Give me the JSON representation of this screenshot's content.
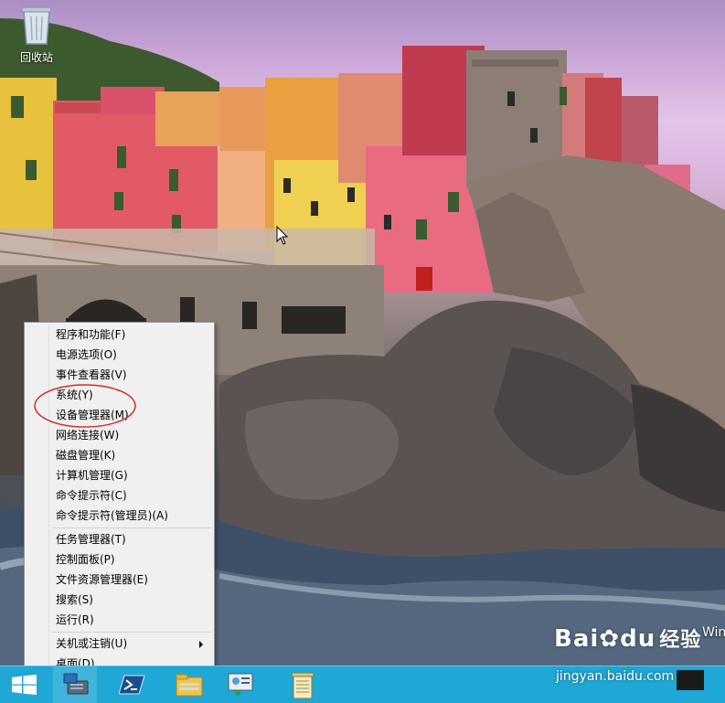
{
  "desktop": {
    "recycle_bin_label": "回收站",
    "edge_text": "Win"
  },
  "watermark": {
    "brand": "Bai",
    "brand_suffix": "du",
    "brand_cn": "经验",
    "url": "jingyan.baidu.com"
  },
  "context_menu": {
    "groups": [
      [
        "程序和功能(F)",
        "电源选项(O)",
        "事件查看器(V)",
        "系统(Y)",
        "设备管理器(M)",
        "网络连接(W)",
        "磁盘管理(K)",
        "计算机管理(G)",
        "命令提示符(C)",
        "命令提示符(管理员)(A)"
      ],
      [
        "任务管理器(T)",
        "控制面板(P)",
        "文件资源管理器(E)",
        "搜索(S)",
        "运行(R)"
      ],
      [
        "关机或注销(U)",
        "桌面(D)"
      ]
    ],
    "items": {
      "programs_features": "程序和功能(F)",
      "power_options": "电源选项(O)",
      "event_viewer": "事件查看器(V)",
      "system": "系统(Y)",
      "device_manager": "设备管理器(M)",
      "network_connections": "网络连接(W)",
      "disk_management": "磁盘管理(K)",
      "computer_management": "计算机管理(G)",
      "command_prompt": "命令提示符(C)",
      "command_prompt_admin": "命令提示符(管理员)(A)",
      "task_manager": "任务管理器(T)",
      "control_panel": "控制面板(P)",
      "file_explorer": "文件资源管理器(E)",
      "search": "搜索(S)",
      "run": "运行(R)",
      "shutdown": "关机或注销(U)",
      "desktop": "桌面(D)"
    }
  },
  "annotation_color": "#d42a2a",
  "taskbar": {
    "color": "#1fa7d6",
    "apps": [
      "server-manager-icon",
      "powershell-icon",
      "file-explorer-icon",
      "network-settings-icon",
      "notepad-icon"
    ]
  }
}
